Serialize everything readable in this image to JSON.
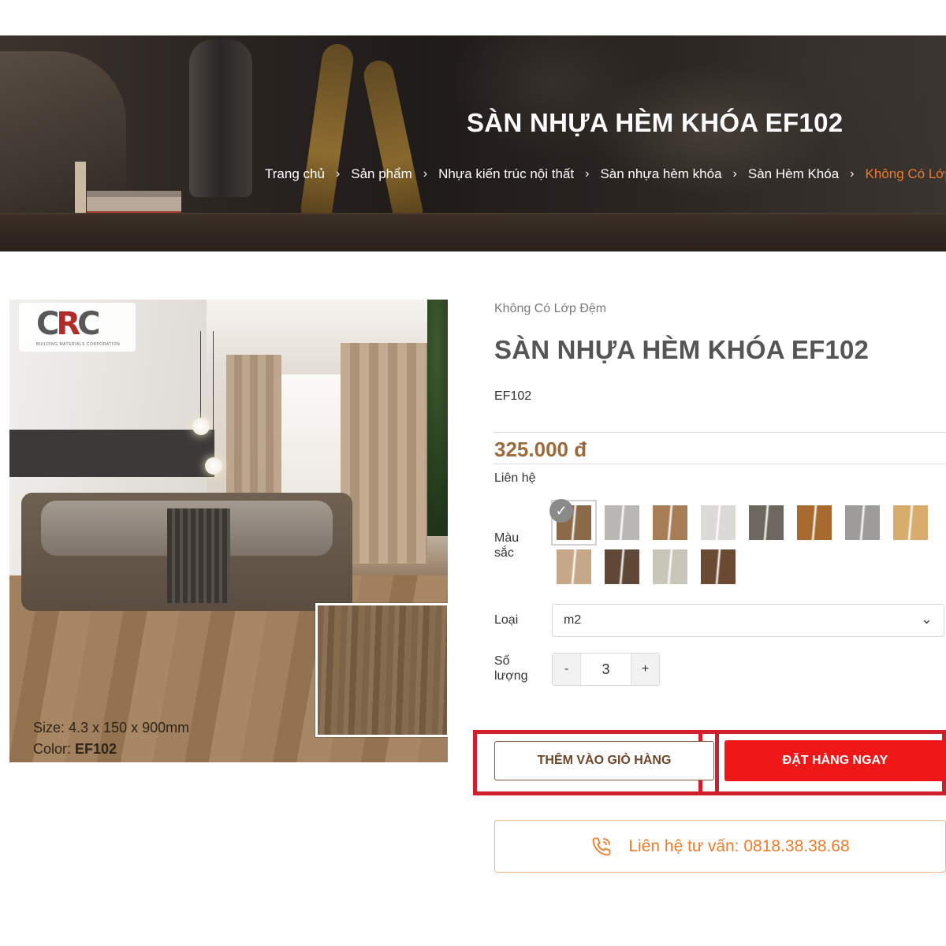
{
  "banner": {
    "title": "SÀN NHỰA HÈM KHÓA EF102",
    "breadcrumb": [
      "Trang chủ",
      "Sản phẩm",
      "Nhựa kiến trúc nội thất",
      "Sàn nhựa hèm khóa",
      "Sàn Hèm Khóa",
      "Không Có Lớp Đệm"
    ],
    "active_color": "#f07b2a"
  },
  "gallery": {
    "logo_text": "CRC",
    "logo_sub": "BUILDING MATERIALS CORPORATION",
    "caption_size": "Size: 4.3 x 150 x 900mm",
    "caption_color_label": "Color:",
    "caption_color_value": "EF102"
  },
  "product": {
    "category": "Không Có Lớp Đệm",
    "title": "SÀN NHỰA HÈM KHÓA EF102",
    "sku": "EF102",
    "price": "325.000 đ",
    "contact": "Liên hệ",
    "price_color": "#9b6b3d"
  },
  "options": {
    "color_label_1": "Màu",
    "color_label_2": "sắc",
    "swatches": [
      {
        "color": "#8a6a48",
        "selected": true
      },
      {
        "color": "#b9b7b3"
      },
      {
        "color": "#a77d55"
      },
      {
        "color": "#dcdad6"
      },
      {
        "color": "#6e675f"
      },
      {
        "color": "#a86a2e"
      },
      {
        "color": "#9d9c9a"
      },
      {
        "color": "#d7ac6c"
      },
      {
        "color": "#c6a888"
      },
      {
        "color": "#5f4838"
      },
      {
        "color": "#c8c6b9"
      },
      {
        "color": "#6a4a32"
      }
    ],
    "type_label": "Loại",
    "type_value": "m2",
    "qty_label_1": "Số",
    "qty_label_2": "lượng",
    "qty_minus": "-",
    "qty_value": "3",
    "qty_plus": "+"
  },
  "actions": {
    "add_to_cart": "THÊM VÀO GIỎ HÀNG",
    "order_now": "ĐẶT HÀNG NGAY",
    "consult": "Liên hệ tư vấn: 0818.38.38.68",
    "order_color": "#ef1717",
    "highlight_color": "#d01e2b"
  }
}
